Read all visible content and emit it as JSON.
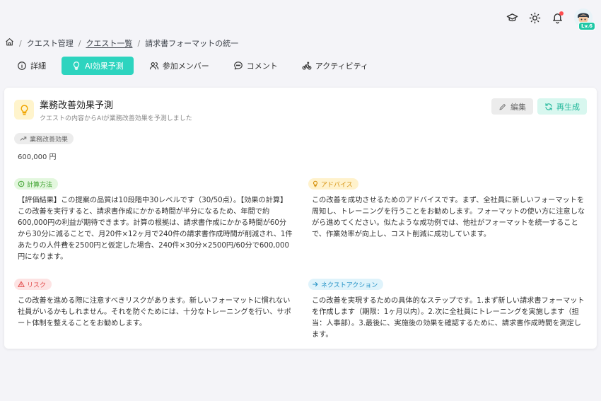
{
  "topbar": {
    "icons": [
      "graduation-cap-icon",
      "sun-icon",
      "bell-icon"
    ],
    "avatar_level": "Lv.6"
  },
  "breadcrumb": {
    "items": [
      "クエスト管理",
      "クエスト一覧",
      "請求書フォーマットの統一"
    ]
  },
  "tabs": [
    {
      "label": "詳細",
      "icon": "info-icon"
    },
    {
      "label": "AI効果予測",
      "icon": "lightbulb-icon",
      "active": true
    },
    {
      "label": "参加メンバー",
      "icon": "users-icon"
    },
    {
      "label": "コメント",
      "icon": "comment-icon"
    },
    {
      "label": "アクティビティ",
      "icon": "activity-icon"
    }
  ],
  "card": {
    "title": "業務改善効果予測",
    "subtitle": "クエストの内容からAIが業務改善効果を予測しました",
    "edit_label": "編集",
    "regenerate_label": "再生成",
    "metric_label": "業務改善効果",
    "metric_value": "600,000 円",
    "sections": {
      "calc": {
        "label": "計算方法",
        "text": "【評価結果】この提案の品質は10段階中30レベルです（30/50点）。【効果の計算】この改善を実行すると、請求書作成にかかる時間が半分になるため、年間で約600,000円の利益が期待できます。計算の根拠は、請求書作成にかかる時間が60分から30分に減ることで、月20件×12ヶ月で240件の請求書作成時間が削減され、1件あたりの人件費を2500円と仮定した場合、240件×30分×2500円/60分で600,000円になります。"
      },
      "advice": {
        "label": "アドバイス",
        "text": "この改善を成功させるためのアドバイスです。まず、全社員に新しいフォーマットを周知し、トレーニングを行うことをお勧めします。フォーマットの使い方に注意しながら進めてください。似たような成功例では、他社がフォーマットを統一することで、作業効率が向上し、コスト削減に成功しています。"
      },
      "risk": {
        "label": "リスク",
        "text": "この改善を進める際に注意すべきリスクがあります。新しいフォーマットに慣れない社員がいるかもしれません。それを防ぐためには、十分なトレーニングを行い、サポート体制を整えることをお勧めします。"
      },
      "next": {
        "label": "ネクストアクション",
        "text": "この改善を実現するための具体的なステップです。1.まず新しい請求書フォーマットを作成します（期限：1ヶ月以内）。2.次に全社員にトレーニングを実施します（担当：人事部）。3.最後に、実施後の効果を確認するために、請求書作成時間を測定します。"
      }
    }
  },
  "colors": {
    "accent": "#2dd4bf",
    "background": "#f4f4f8"
  }
}
